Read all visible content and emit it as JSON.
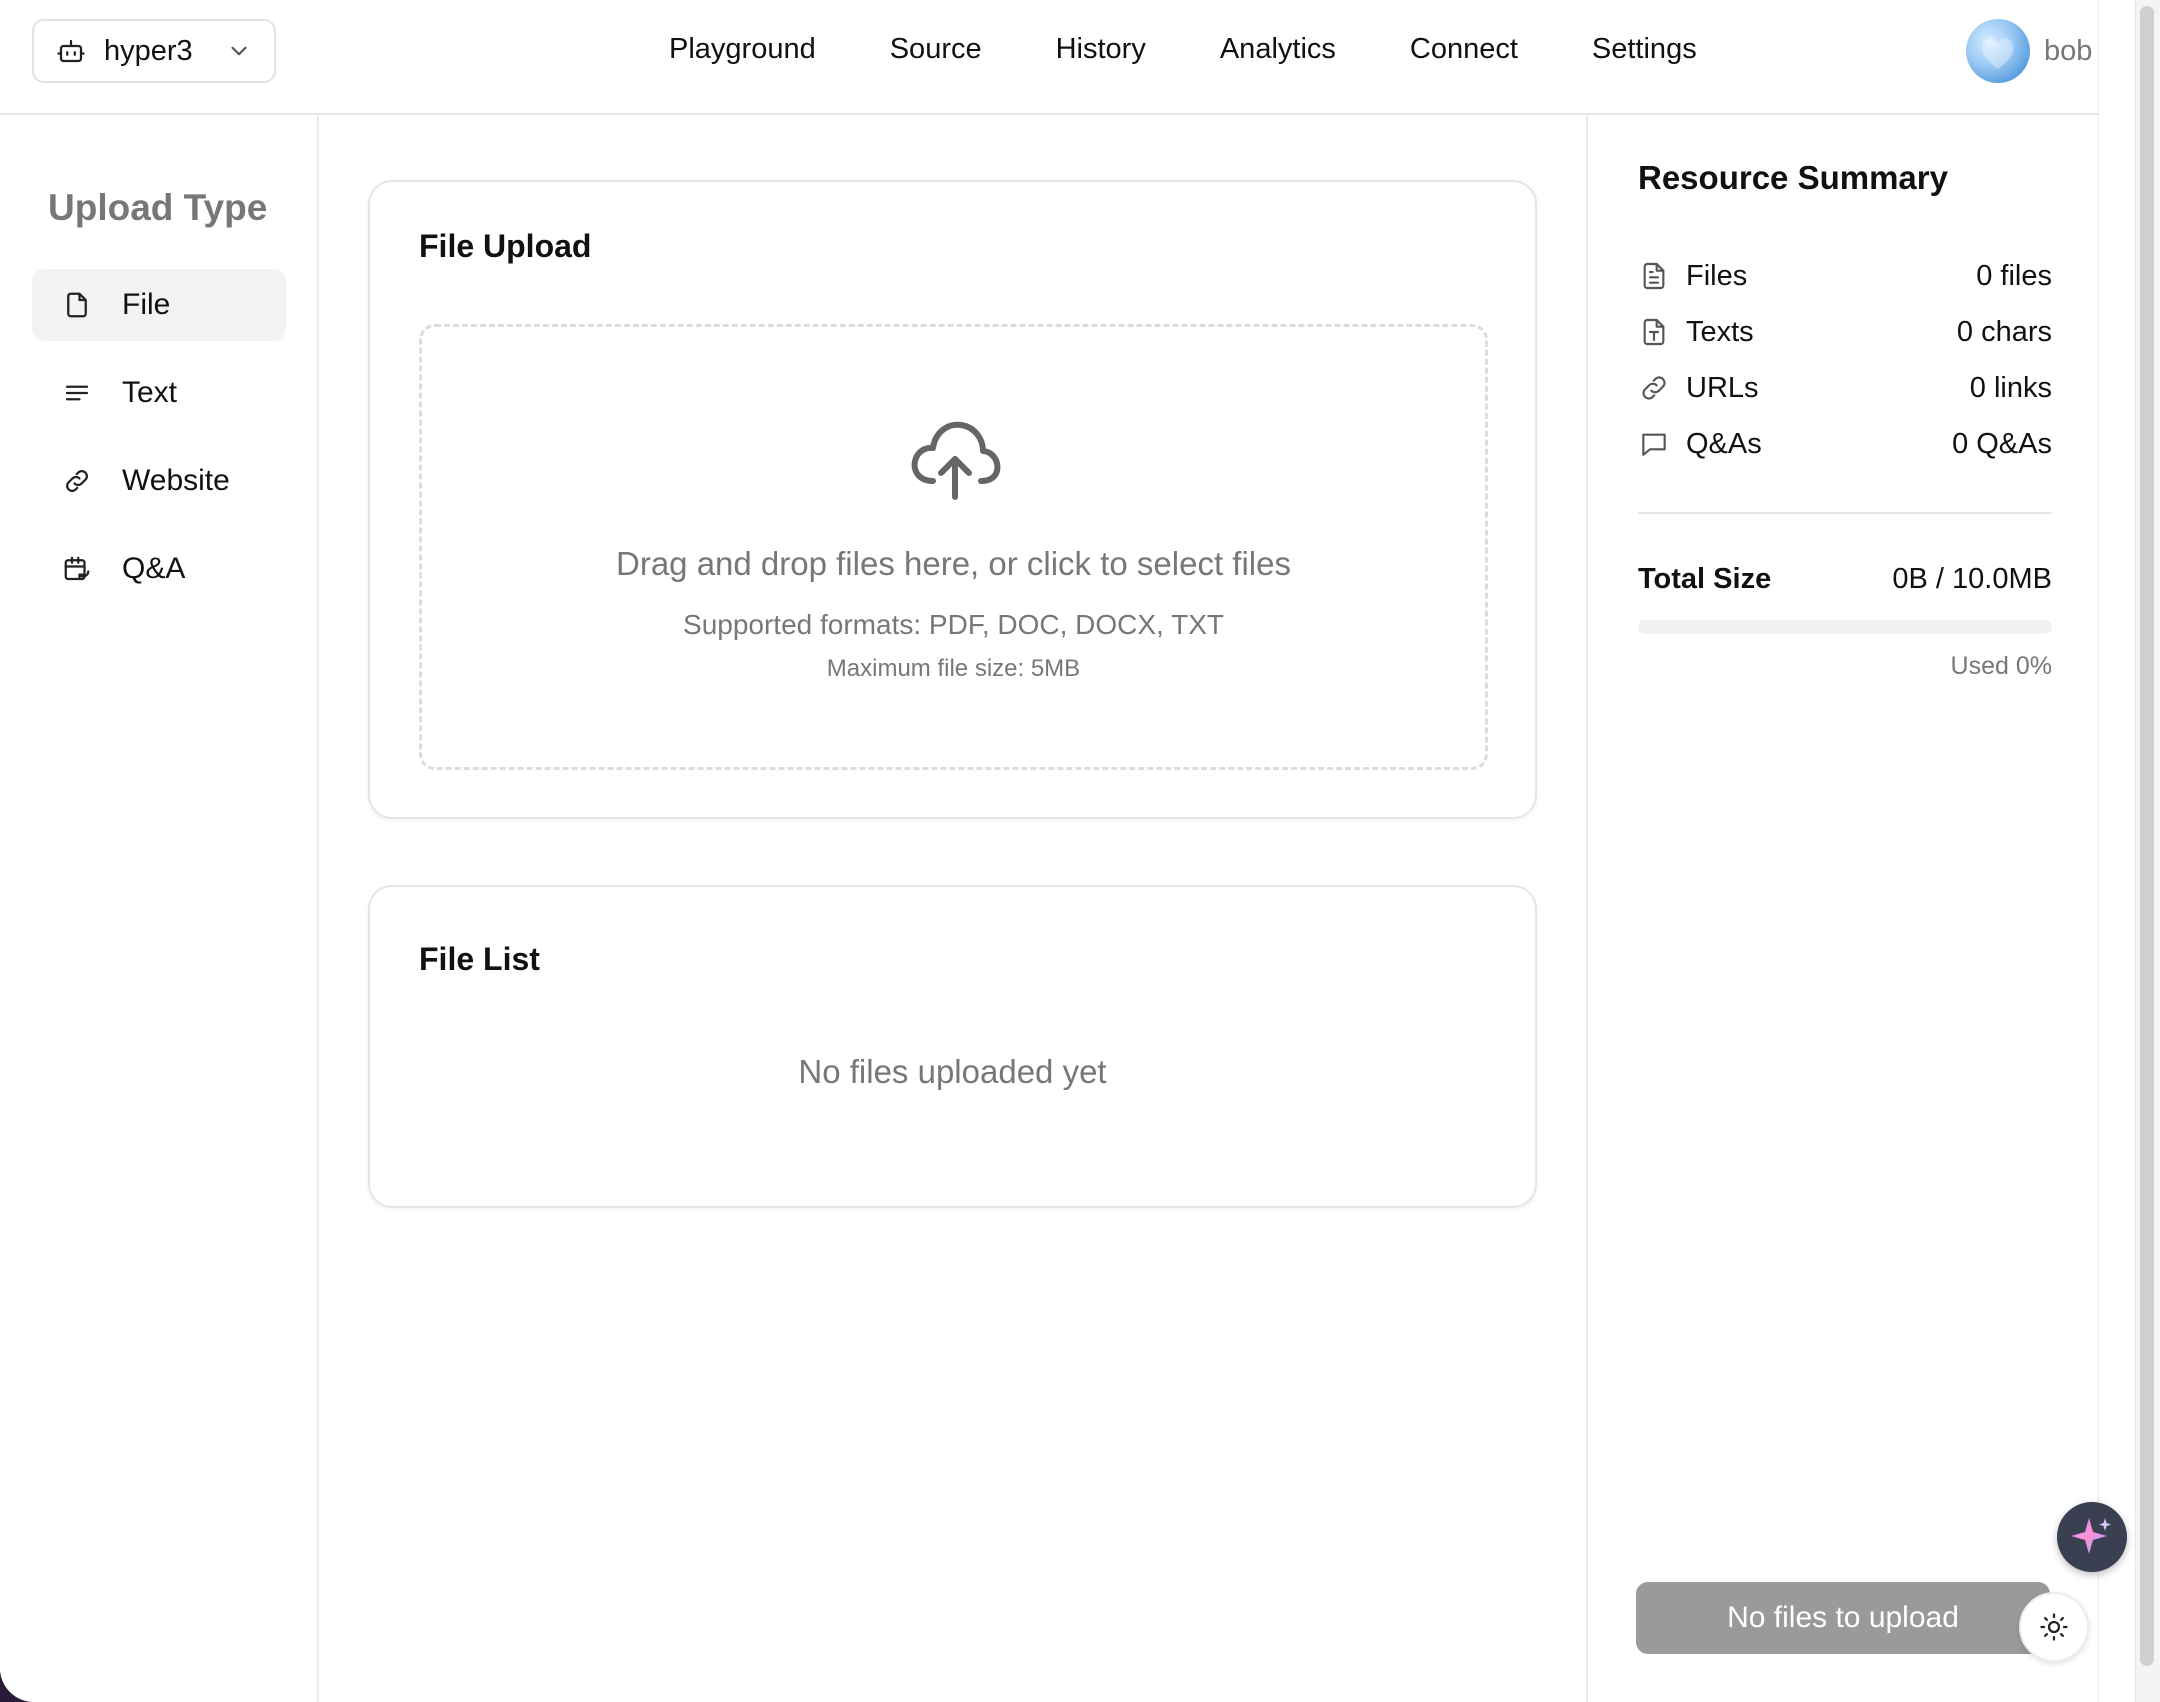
{
  "header": {
    "bot_selector": {
      "value": "hyper3",
      "icon": "robot-icon"
    },
    "nav": [
      "Playground",
      "Source",
      "History",
      "Analytics",
      "Connect",
      "Settings"
    ],
    "user": {
      "name": "bob"
    }
  },
  "sidebar": {
    "title": "Upload Type",
    "items": [
      {
        "label": "File",
        "icon": "file-icon",
        "active": true
      },
      {
        "label": "Text",
        "icon": "text-lines-icon",
        "active": false
      },
      {
        "label": "Website",
        "icon": "link-icon",
        "active": false
      },
      {
        "label": "Q&A",
        "icon": "calendar-refresh-icon",
        "active": false
      }
    ]
  },
  "upload_card": {
    "title": "File Upload",
    "dropzone": {
      "main": "Drag and drop files here, or click to select files",
      "formats": "Supported formats: PDF, DOC, DOCX, TXT",
      "max_size": "Maximum file size: 5MB"
    }
  },
  "list_card": {
    "title": "File List",
    "empty": "No files uploaded yet"
  },
  "summary": {
    "title": "Resource Summary",
    "rows": [
      {
        "name": "Files",
        "value": "0 files",
        "icon": "document-icon"
      },
      {
        "name": "Texts",
        "value": "0 chars",
        "icon": "text-file-icon"
      },
      {
        "name": "URLs",
        "value": "0 links",
        "icon": "link-icon"
      },
      {
        "name": "Q&As",
        "value": "0 Q&As",
        "icon": "chat-bubble-icon"
      }
    ],
    "total_label": "Total Size",
    "total_value": "0B / 10.0MB",
    "used_percent": 0,
    "used_label": "Used 0%",
    "upload_button": "No files to upload"
  }
}
